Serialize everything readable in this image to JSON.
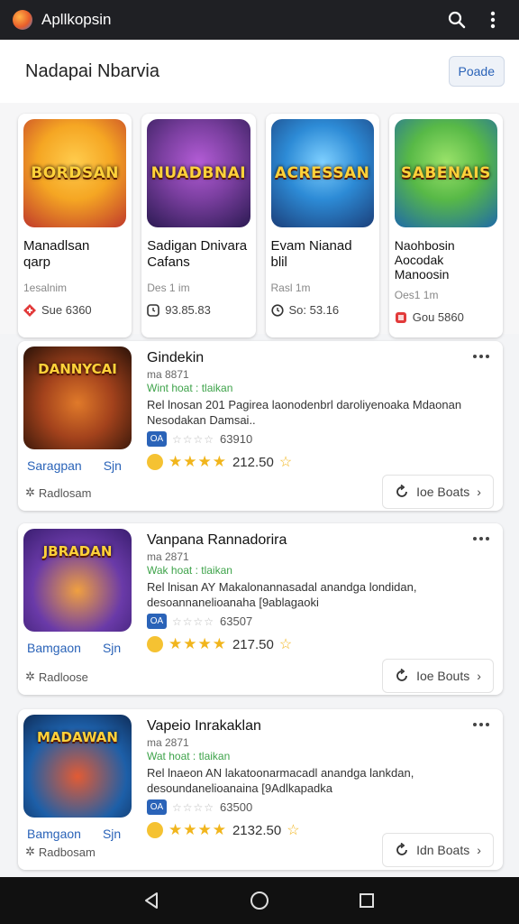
{
  "app": {
    "title": "Apllkopsin"
  },
  "toolbar": {
    "search_icon": "search-icon",
    "more_icon": "more-vert-icon"
  },
  "section": {
    "title": "Nadapai Nbarvia",
    "button_label": "Poade"
  },
  "featured": [
    {
      "banner": "BORDSAN",
      "title": "Manadlsan\nqarp",
      "subtitle": "1esalnim",
      "meta_icon": "red-badge-icon",
      "meta": "Sue 6360",
      "colors": [
        "#f5a623",
        "#c0392b"
      ]
    },
    {
      "banner": "NUADBNAI",
      "title": "Sadigan Dnivara\nCafans",
      "subtitle": "Des 1 im",
      "meta_icon": "square-clock-icon",
      "meta": "93.85.83",
      "colors": [
        "#7b3fa0",
        "#2b1a52"
      ]
    },
    {
      "banner": "ACRESSAN",
      "title": "Evam Nianad\nblil",
      "subtitle": "Rasl 1m",
      "meta_icon": "circle-clock-icon",
      "meta": "So: 53.16",
      "colors": [
        "#2d8bd6",
        "#1b3f7a"
      ]
    },
    {
      "banner": "SABENAIS",
      "title": "Naohbosin\nAocodak\nManoosin",
      "subtitle": "Oes1 1m",
      "meta_icon": "red-square-icon",
      "meta": "Gou 5860",
      "colors": [
        "#58b947",
        "#1f6aa8"
      ]
    }
  ],
  "list": [
    {
      "banner": "DANNYCAI",
      "title": "Gindekin",
      "version": "ma 8871",
      "status": "Wint hoat : tlaikan",
      "description": "Rel lnosan 201 Pagirea laonodenbrl daroliyenoaka Mdaonan Nesodakan Damsai..",
      "tag": "OA",
      "rating_count": "63910",
      "score": "212.50",
      "actions": [
        "Saragpan",
        "Sjn"
      ],
      "footer_label": "Radlosam",
      "button_label": "Ioe Boats",
      "colors": [
        "#a3421c",
        "#2a1208"
      ]
    },
    {
      "banner": "JBRADAN",
      "title": "Vanpana Rannadorira",
      "version": "ma 2871",
      "status": "Wak hoat : tlaikan",
      "description": "Rel lnisan AY Makalonannasadal anandga londidan, desoannanelioanaha [9ablagaoki",
      "tag": "OA",
      "rating_count": "63507",
      "score": "217.50",
      "actions": [
        "Bamgaon",
        "Sjn"
      ],
      "footer_label": "Radloose",
      "button_label": "Ioe Bouts",
      "colors": [
        "#6a3aa8",
        "#e0742a"
      ]
    },
    {
      "banner": "MADAWAN",
      "title": "Vapeio Inrakaklan",
      "version": "ma 2871",
      "status": "Wat hoat : tlaikan",
      "description": "Rel lnaeon AN lakatoonarmacadl anandga lankdan, desoundanelioanaina [9Adlkapadka",
      "tag": "OA",
      "rating_count": "63500",
      "score": "2132.50",
      "actions": [
        "Bamgaon",
        "Sjn"
      ],
      "footer_label": "Radbosam",
      "button_label": "Idn Boats",
      "colors": [
        "#1d5fa8",
        "#b8402a"
      ]
    }
  ],
  "navigation": {
    "back": "back-icon",
    "home": "home-icon",
    "recents": "recents-icon"
  }
}
